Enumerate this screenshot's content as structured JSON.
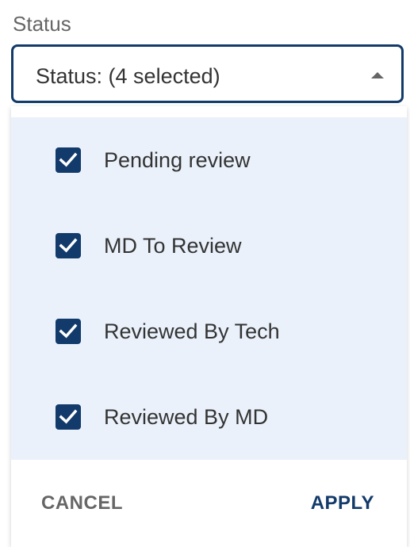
{
  "field": {
    "label": "Status",
    "value": "Status: (4 selected)",
    "caret_icon": "caret-up-icon"
  },
  "options": [
    {
      "label": "Pending review",
      "checked": true
    },
    {
      "label": "MD To Review",
      "checked": true
    },
    {
      "label": "Reviewed By Tech",
      "checked": true
    },
    {
      "label": "Reviewed By MD",
      "checked": true
    }
  ],
  "actions": {
    "cancel_label": "CANCEL",
    "apply_label": "APPLY"
  },
  "colors": {
    "accent": "#123a6a",
    "option_background": "#eaf1fb",
    "muted_text": "#666666"
  }
}
